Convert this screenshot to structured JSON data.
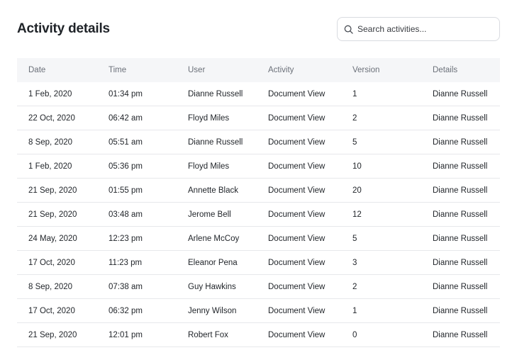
{
  "header": {
    "title": "Activity details"
  },
  "search": {
    "placeholder": "Search activities...",
    "icon": "search-icon"
  },
  "table": {
    "columns": [
      "Date",
      "Time",
      "User",
      "Activity",
      "Version",
      "Details"
    ],
    "rows": [
      [
        "1 Feb, 2020",
        "01:34 pm",
        "Dianne Russell",
        "Document View",
        "1",
        "Dianne Russell"
      ],
      [
        "22 Oct, 2020",
        "06:42 am",
        "Floyd Miles",
        "Document View",
        "2",
        "Dianne Russell"
      ],
      [
        "8 Sep, 2020",
        "05:51 am",
        "Dianne Russell",
        "Document View",
        "5",
        "Dianne Russell"
      ],
      [
        "1 Feb, 2020",
        "05:36 pm",
        "Floyd Miles",
        "Document View",
        "10",
        "Dianne Russell"
      ],
      [
        "21 Sep, 2020",
        "01:55 pm",
        "Annette Black",
        "Document View",
        "20",
        "Dianne Russell"
      ],
      [
        "21 Sep, 2020",
        "03:48 am",
        "Jerome Bell",
        "Document View",
        "12",
        "Dianne Russell"
      ],
      [
        "24 May, 2020",
        "12:23 pm",
        "Arlene McCoy",
        "Document View",
        "5",
        "Dianne Russell"
      ],
      [
        "17 Oct, 2020",
        "11:23 pm",
        "Eleanor Pena",
        "Document View",
        "3",
        "Dianne Russell"
      ],
      [
        "8 Sep, 2020",
        "07:38 am",
        "Guy Hawkins",
        "Document View",
        "2",
        "Dianne Russell"
      ],
      [
        "17 Oct, 2020",
        "06:32 pm",
        "Jenny Wilson",
        "Document View",
        "1",
        "Dianne Russell"
      ],
      [
        "21 Sep, 2020",
        "12:01 pm",
        "Robert Fox",
        "Document View",
        "0",
        "Dianne Russell"
      ]
    ]
  }
}
